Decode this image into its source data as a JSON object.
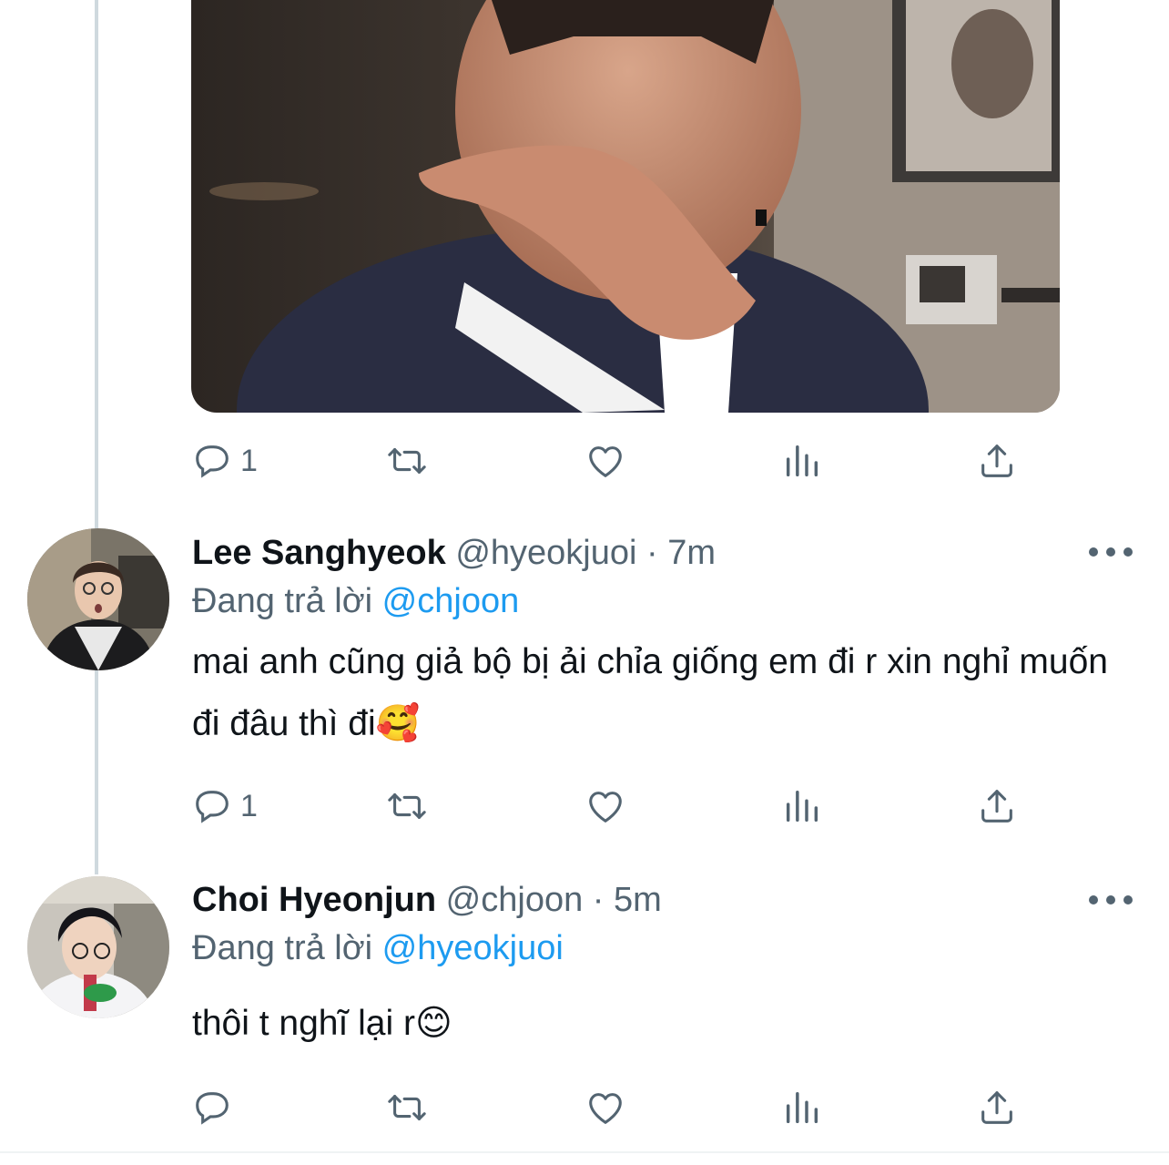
{
  "colors": {
    "accent": "#1d9bf0",
    "muted": "#536471",
    "text": "#0f1419",
    "thread_line": "#cfd9de"
  },
  "tweets": [
    {
      "actions": {
        "reply_count": "1"
      }
    },
    {
      "display_name": "Lee Sanghyeok",
      "handle": "@hyeokjuoi",
      "separator": "·",
      "time": "7m",
      "reply_prefix": "Đang trả lời",
      "reply_to": "@chjoon",
      "text": "mai anh cũng giả bộ bị ải chỉa giống em đi r xin nghỉ muốn đi đâu thì đi🥰",
      "actions": {
        "reply_count": "1"
      }
    },
    {
      "display_name": "Choi Hyeonjun",
      "handle": "@chjoon",
      "separator": "·",
      "time": "5m",
      "reply_prefix": "Đang trả lời",
      "reply_to": "@hyeokjuoi",
      "text": "thôi t nghĩ lại r😊",
      "actions": {
        "reply_count": ""
      }
    }
  ],
  "icons": [
    "reply-icon",
    "retweet-icon",
    "like-icon",
    "analytics-icon",
    "share-icon",
    "more-icon"
  ]
}
